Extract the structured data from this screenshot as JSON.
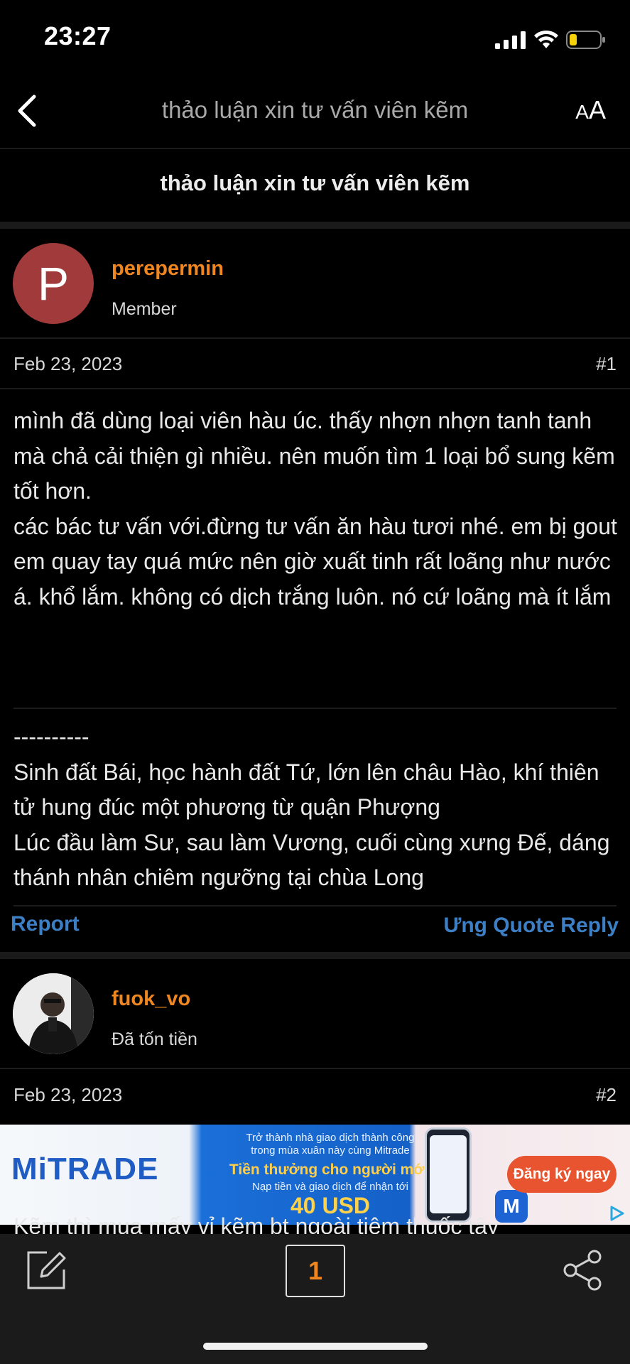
{
  "status_bar": {
    "time": "23:27"
  },
  "nav": {
    "title": "thảo luận xin tư vấn viên kẽm",
    "font_size_label": "AA"
  },
  "thread": {
    "title": "thảo luận xin tư vấn viên kẽm"
  },
  "posts": [
    {
      "avatar_letter": "P",
      "avatar_color": "#a13a3a",
      "username": "perepermin",
      "user_title": "Member",
      "date": "Feb 23, 2023",
      "number": "#1",
      "body": [
        "mình đã dùng loại viên hàu úc. thấy nhợn nhợn tanh tanh mà chả cải thiện gì nhiều. nên muốn tìm 1 loại bổ sung kẽm tốt hơn.",
        "các bác tư vấn với.đừng tư vấn ăn hàu tươi nhé. em bị gout",
        "em quay tay quá mức nên giờ xuất tinh rất loãng như nước á. khổ lắm. không có dịch trắng luôn. nó cứ loãng mà ít lắm"
      ],
      "signature": [
        "----------",
        "Sinh đất Bái, học hành đất Tứ, lớn lên châu Hào, khí thiên tử hung đúc một phương từ quận Phượng",
        "Lúc đầu làm Sư, sau làm Vương, cuối cùng xưng Đế, dáng thánh nhân chiêm ngưỡng tại chùa Long"
      ],
      "actions": {
        "report": "Report",
        "right": "Ưng Quote Reply"
      }
    },
    {
      "username": "fuok_vo",
      "user_title": "Đã tốn tiền",
      "date": "Feb 23, 2023",
      "number": "#2",
      "body_partial": "Kẽm thì mua mấy vỉ kẽm bt ngoài tiệm thuốc tây"
    }
  ],
  "ad": {
    "brand": "MiTRADE",
    "line1": "Trở thành nhà giao dịch thành công trong mùa xuân này cùng Mitrade",
    "line2": "Tiền thưởng cho người mới",
    "line3": "Nạp tiền và giao dịch để nhận tới",
    "line4": "40 USD",
    "cta": "Đăng ký ngay"
  },
  "bottom_bar": {
    "page": "1"
  },
  "colors": {
    "accent_orange": "#f0861f",
    "link_blue": "#3d7fc4",
    "background": "#000000"
  }
}
